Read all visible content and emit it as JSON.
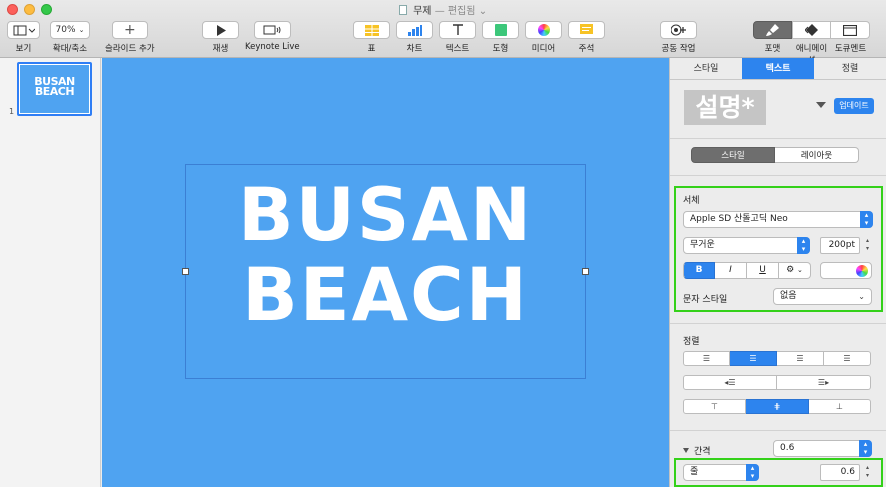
{
  "window": {
    "title": "무제",
    "separator": "—",
    "status": "편집됨",
    "controls": [
      "close",
      "minimize",
      "zoom"
    ]
  },
  "toolbar": {
    "view_label": "보기",
    "zoom_value": "70%",
    "zoom_label": "확대/축소",
    "add_slide_label": "슬라이드 추가",
    "play_label": "재생",
    "keynote_live_label": "Keynote Live",
    "table_label": "표",
    "chart_label": "차트",
    "text_label": "텍스트",
    "shape_label": "도형",
    "media_label": "미디어",
    "comment_label": "주석",
    "collaborate_label": "공동 작업",
    "format_label": "포맷",
    "animate_label": "애니메이션",
    "document_label": "도큐멘트",
    "icons": {
      "view": "sidebar-icon",
      "add_slide": "plus-icon",
      "play": "play-icon",
      "keynote_live": "broadcast-icon",
      "table": "table-icon",
      "chart": "bar-chart-icon",
      "text": "text-icon",
      "shape": "square-shape-icon",
      "media": "photos-icon",
      "comment": "comment-icon",
      "collaborate": "collaborate-icon",
      "format": "paintbrush-icon",
      "animate": "diamond-icon",
      "document": "document-icon"
    }
  },
  "navigator": {
    "slides": [
      {
        "number": "1",
        "line1": "BUSAN",
        "line2": "BEACH"
      }
    ]
  },
  "slide": {
    "line1": "BUSAN",
    "line2": "BEACH",
    "background_color": "#4fa3f1",
    "text_color": "#ffffff"
  },
  "inspector": {
    "tabs": [
      {
        "label": "스타일",
        "active": false
      },
      {
        "label": "텍스트",
        "active": true
      },
      {
        "label": "정렬",
        "active": false
      }
    ],
    "paragraph_style_preview": "설명*",
    "update_button": "업데이트",
    "sub_tabs": [
      {
        "label": "스타일",
        "active": true
      },
      {
        "label": "레이아웃",
        "active": false
      }
    ],
    "font": {
      "section_label": "서체",
      "family": "Apple SD 산돌고딕 Neo",
      "weight": "무거운",
      "size": "200pt",
      "bold": "B",
      "italic": "I",
      "underline": "U",
      "gear": "⚙",
      "character_style_label": "문자 스타일",
      "character_style_value": "없음"
    },
    "alignment": {
      "section_label": "정렬",
      "horizontal": [
        "left",
        "center",
        "right",
        "justify"
      ],
      "selected_horizontal": "center",
      "vertical": [
        "top",
        "middle",
        "bottom"
      ],
      "selected_vertical": "middle"
    },
    "spacing": {
      "section_label": "간격",
      "value": "0.6",
      "line_type": "줄",
      "line_value": "0.6"
    },
    "accent_color": "#2d84ee",
    "highlight_color": "#34d11a"
  }
}
